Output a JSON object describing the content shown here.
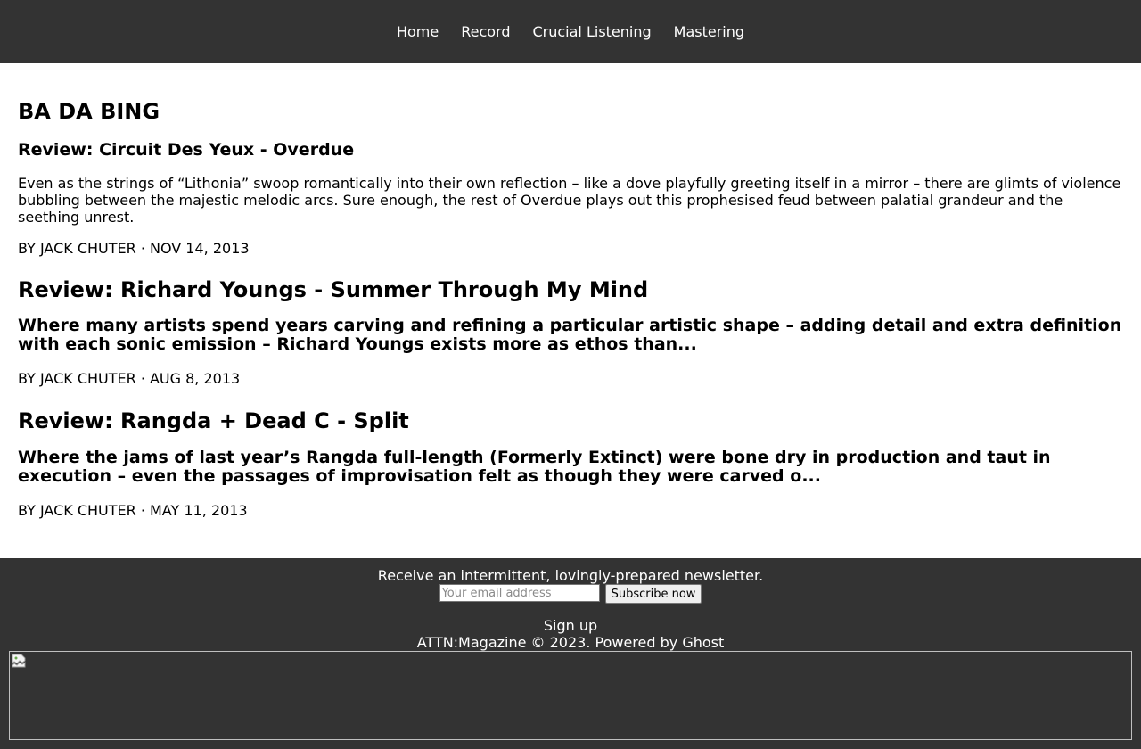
{
  "nav": {
    "items": [
      {
        "label": "Home"
      },
      {
        "label": "Record"
      },
      {
        "label": "Crucial Listening"
      },
      {
        "label": "Mastering"
      }
    ]
  },
  "site": {
    "title": "BA DA BING"
  },
  "posts": [
    {
      "title": "Review: Circuit Des Yeux - Overdue",
      "excerpt": "Even as the strings of “Lithonia” swoop romantically into their own reflection – like a dove playfully greeting itself in a mirror – there are glimts of violence bubbling between the majestic melodic arcs. Sure enough, the rest of Overdue plays out this prophesised feud between palatial grandeur and the seething unrest.",
      "meta": "BY JACK CHUTER · NOV 14, 2013"
    },
    {
      "title": "Review: Richard Youngs - Summer Through My Mind",
      "excerpt": "Where many artists spend years carving and refining a particular artistic shape – adding detail and extra definition with each sonic emission – Richard Youngs exists more as ethos than...",
      "meta": "BY JACK CHUTER · AUG 8, 2013"
    },
    {
      "title": "Review: Rangda + Dead C - Split",
      "excerpt": "Where the jams of last year’s Rangda full-length (Formerly Extinct) were bone dry in production and taut in execution – even the passages of improvisation felt as though they were carved o...",
      "meta": "BY JACK CHUTER · MAY 11, 2013"
    }
  ],
  "footer": {
    "newsletter_text": "Receive an intermittent, lovingly-prepared newsletter.",
    "email_placeholder": "Your email address",
    "email_value": "",
    "subscribe_label": "Subscribe now",
    "signup_label": "Sign up",
    "copyright": "ATTN:Magazine © 2023. Powered by Ghost",
    "image_icon": "broken-image-icon"
  },
  "colors": {
    "header_bg": "#333333",
    "footer_bg": "#333333",
    "nav_text": "#ffffff",
    "body_text": "#000000"
  }
}
